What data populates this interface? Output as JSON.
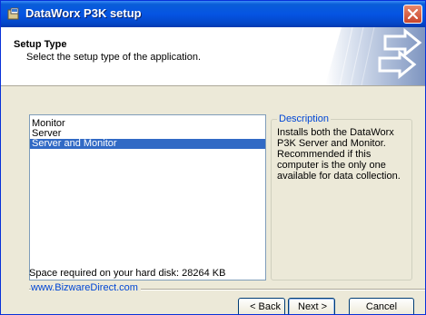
{
  "window": {
    "title": "DataWorx P3K setup",
    "close_icon": "close-icon",
    "app_icon": "setup-package-icon"
  },
  "header": {
    "title": "Setup Type",
    "subtitle": "Select the setup type of the application.",
    "art_icon": "installer-arrows-icon"
  },
  "setup_types": {
    "items": [
      "Monitor",
      "Server",
      "Server and Monitor"
    ],
    "selected": "Server and Monitor"
  },
  "description": {
    "legend": "Description",
    "text": "Installs both the DataWorx P3K Server and Monitor. Recommended if this computer is the only one available for data collection."
  },
  "disk": {
    "space_text": "Space required on your hard disk: 28264 KB"
  },
  "brand": {
    "text": "www.BizwareDirect.com"
  },
  "buttons": {
    "back": "< Back",
    "next": "Next >",
    "cancel": "Cancel"
  },
  "colors": {
    "titlebar": "#0554e3",
    "selection": "#316ac5",
    "legend": "#0046d5",
    "dialog_bg": "#ece9d8"
  }
}
